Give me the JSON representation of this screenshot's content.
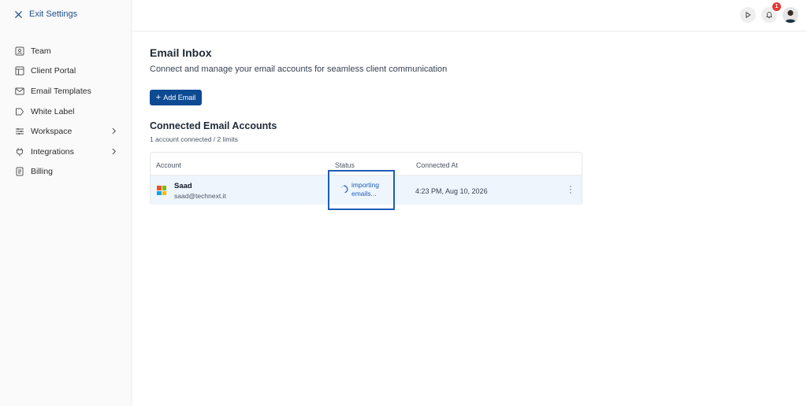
{
  "sidebar": {
    "exit_label": "Exit Settings",
    "items": [
      {
        "label": "Team",
        "icon": "person-square-icon"
      },
      {
        "label": "Client Portal",
        "icon": "layout-icon"
      },
      {
        "label": "Email Templates",
        "icon": "mail-icon"
      },
      {
        "label": "White Label",
        "icon": "label-tag-icon"
      },
      {
        "label": "Workspace",
        "icon": "sliders-icon",
        "has_submenu": true
      },
      {
        "label": "Integrations",
        "icon": "plug-icon",
        "has_submenu": true
      },
      {
        "label": "Billing",
        "icon": "document-icon"
      }
    ]
  },
  "topbar": {
    "notification_count": "1"
  },
  "main": {
    "title": "Email Inbox",
    "subtitle": "Connect and manage your email accounts for seamless client communication",
    "add_button_label": "Add Email",
    "section_title": "Connected Email Accounts",
    "section_subtitle": "1 account connected / 2 limits",
    "table": {
      "headers": [
        "Account",
        "Status",
        "Connected At"
      ],
      "rows": [
        {
          "name": "Saad",
          "email": "saad@technext.it",
          "status": "importing emails...",
          "connected_at": "4:23 PM, Aug 10, 2026"
        }
      ]
    }
  },
  "colors": {
    "accent": "#0d4a93",
    "link": "#1f4e8c",
    "status": "#1d5eb5",
    "badge": "#e53935",
    "row_highlight": "#eef5fc"
  }
}
